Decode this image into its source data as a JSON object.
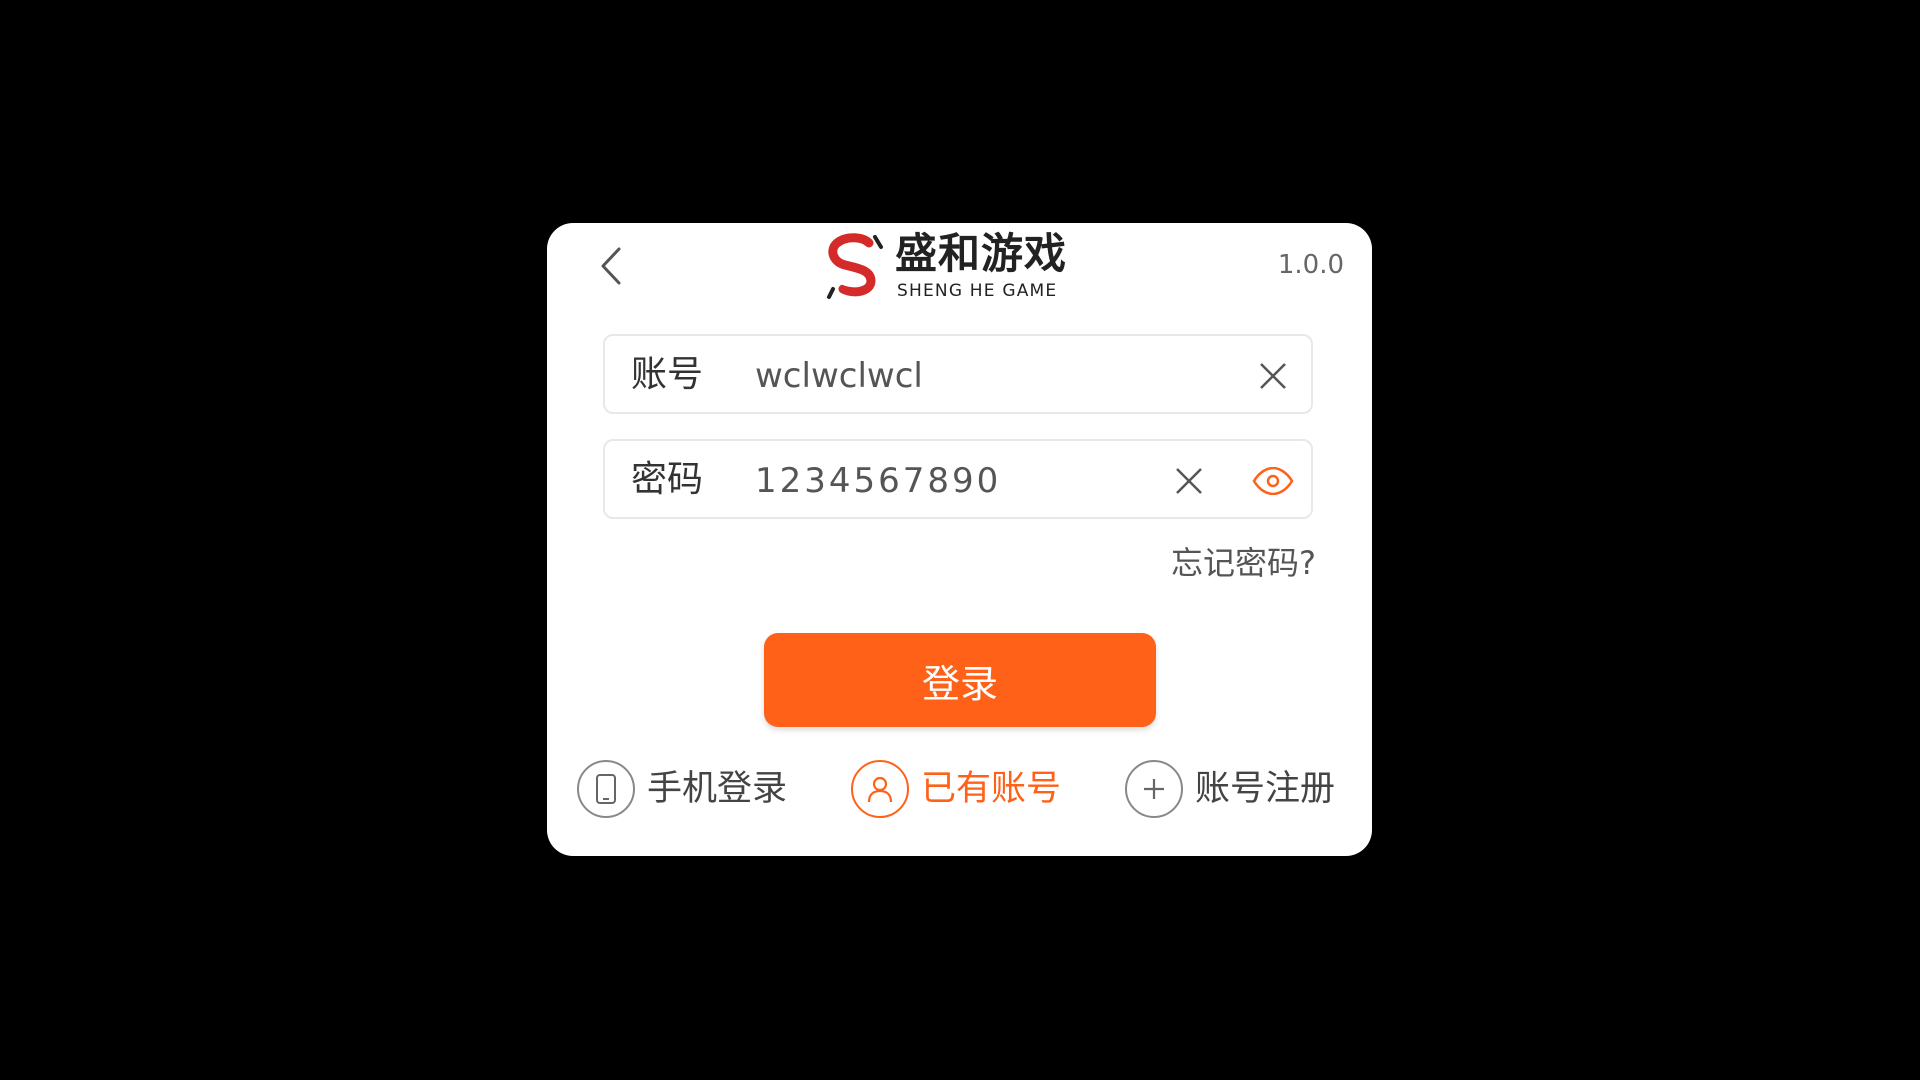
{
  "header": {
    "back_icon": "chevron-left-icon",
    "version": "1.0.0",
    "logo": {
      "cn": "盛和游戏",
      "en": "SHENG HE GAME"
    }
  },
  "form": {
    "account": {
      "label": "账号",
      "value": "wclwclwcl",
      "clear_icon": "close-icon"
    },
    "password": {
      "label": "密码",
      "value": "1234567890",
      "clear_icon": "close-icon",
      "toggle_icon": "eye-icon"
    },
    "forgot_label": "忘记密码?",
    "login_label": "登录"
  },
  "bottom_nav": {
    "items": [
      {
        "label": "手机登录",
        "icon": "phone-icon",
        "active": false
      },
      {
        "label": "已有账号",
        "icon": "user-icon",
        "active": true
      },
      {
        "label": "账号注册",
        "icon": "plus-icon",
        "active": false
      }
    ]
  },
  "colors": {
    "accent": "#ff6119",
    "background": "#000000",
    "card": "#ffffff",
    "logo_red": "#d42a2a"
  }
}
